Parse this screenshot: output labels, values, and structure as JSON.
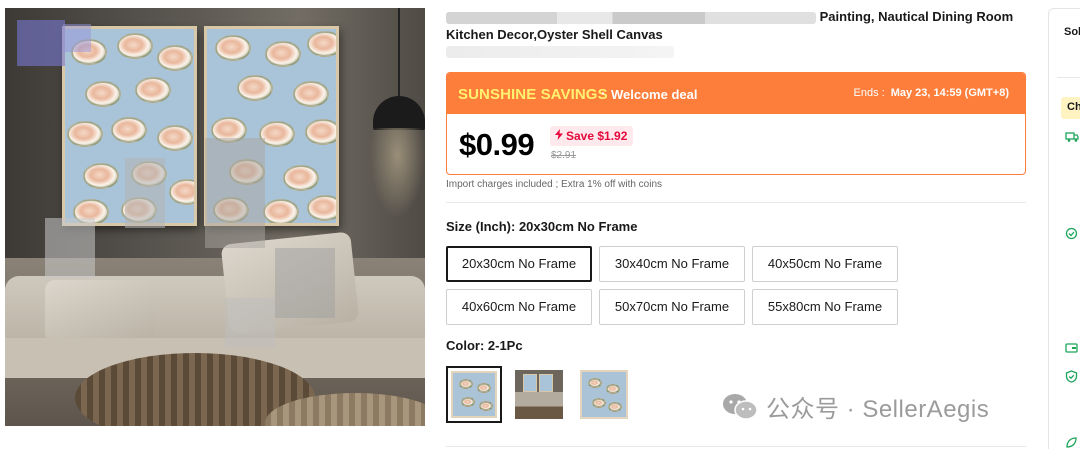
{
  "product": {
    "title_visible": "Painting, Nautical Dining Room",
    "title_line2": "Kitchen Decor,Oyster Shell Canvas"
  },
  "deal": {
    "brand": "SUNSHINE SAVINGS",
    "separator": "·",
    "label": "Welcome deal",
    "ends_label": "Ends :",
    "ends_value": "May 23, 14:59 (GMT+8)",
    "price": "$0.99",
    "save": "Save $1.92",
    "save_icon": "lightning-icon",
    "original_price": "$2.91",
    "colors": {
      "header": "#fd7e3a",
      "brand_text": "#fff170",
      "save_text": "#e4083b",
      "save_bg": "#ffe9ec"
    }
  },
  "import_note": "Import charges included ; Extra 1% off with coins",
  "size": {
    "label": "Size (Inch): 20x30cm No Frame",
    "options": [
      "20x30cm No Frame",
      "30x40cm No Frame",
      "40x50cm No Frame",
      "40x60cm No Frame",
      "50x70cm No Frame",
      "55x80cm No Frame"
    ],
    "selected_index": 0
  },
  "color": {
    "label": "Color: 2-1Pc",
    "selected_index": 0
  },
  "watermark": "公众号 · SellerAegis",
  "side_panel": {
    "sold_label": "Sol",
    "choice_badge": "Ch",
    "icons": [
      "truck-icon",
      "return-icon",
      "wallet-icon",
      "shield-check-icon",
      "leaf-icon"
    ]
  }
}
